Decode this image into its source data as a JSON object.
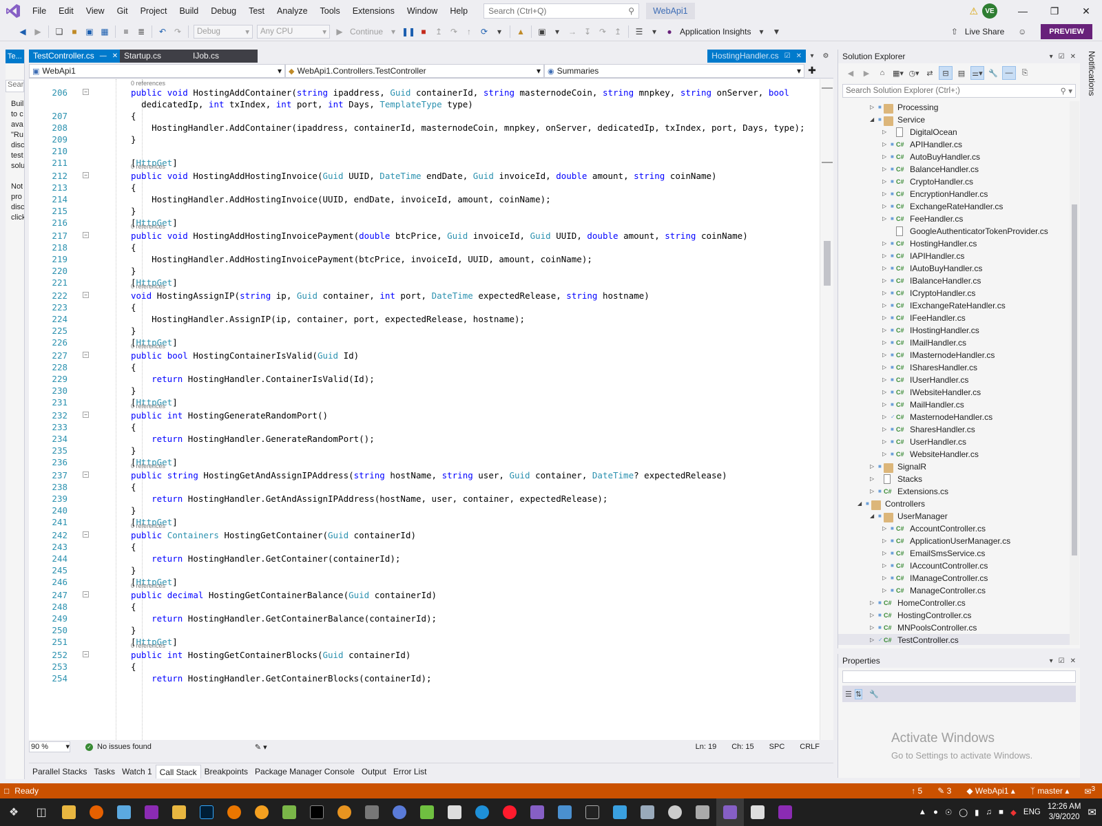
{
  "menu": {
    "items": [
      "File",
      "Edit",
      "View",
      "Git",
      "Project",
      "Build",
      "Debug",
      "Test",
      "Analyze",
      "Tools",
      "Extensions",
      "Window",
      "Help"
    ],
    "search_placeholder": "Search (Ctrl+Q)",
    "app_name": "WebApi1",
    "user_initials": "VE"
  },
  "toolbar": {
    "config": "Debug",
    "platform": "Any CPU",
    "continue_label": "Continue",
    "insights_label": "Application Insights",
    "live_share_label": "Live Share",
    "preview_label": "PREVIEW"
  },
  "left_panel": {
    "tab": "Te...",
    "search": "Sear",
    "text_lines": [
      "Buil",
      "to c",
      "ava",
      "\"Ru",
      "disc",
      "test",
      "solu",
      "",
      "Not",
      "pro",
      "disc",
      "click"
    ]
  },
  "doc_tabs": [
    {
      "label": "TestController.cs",
      "active": true
    },
    {
      "label": "Startup.cs",
      "active": false
    },
    {
      "label": "IJob.cs",
      "active": false
    }
  ],
  "doc_tab_right": "HostingHandler.cs",
  "nav": {
    "project": "WebApi1",
    "class": "WebApi1.Controllers.TestController",
    "member": "Summaries"
  },
  "code": {
    "refs_label": "0 references",
    "lines": [
      {
        "n": "206",
        "t": "public void HostingAddContainer(string ipaddress, Guid containerId, string masternodeCoin, string mnpkey, string onServer, bool"
      },
      {
        "n": "",
        "t": "  dedicatedIp, int txIndex, int port, int Days, TemplateType type)"
      },
      {
        "n": "207",
        "t": "{"
      },
      {
        "n": "208",
        "t": "    HostingHandler.AddContainer(ipaddress, containerId, masternodeCoin, mnpkey, onServer, dedicatedIp, txIndex, port, Days, type);"
      },
      {
        "n": "209",
        "t": "}"
      },
      {
        "n": "210",
        "t": ""
      },
      {
        "n": "211",
        "t": "[HttpGet]"
      },
      {
        "n": "212",
        "t": "public void HostingAddHostingInvoice(Guid UUID, DateTime endDate, Guid invoiceId, double amount, string coinName)"
      },
      {
        "n": "213",
        "t": "{"
      },
      {
        "n": "214",
        "t": "    HostingHandler.AddHostingInvoice(UUID, endDate, invoiceId, amount, coinName);"
      },
      {
        "n": "215",
        "t": "}"
      },
      {
        "n": "216",
        "t": "[HttpGet]"
      },
      {
        "n": "217",
        "t": "public void HostingAddHostingInvoicePayment(double btcPrice, Guid invoiceId, Guid UUID, double amount, string coinName)"
      },
      {
        "n": "218",
        "t": "{"
      },
      {
        "n": "219",
        "t": "    HostingHandler.AddHostingInvoicePayment(btcPrice, invoiceId, UUID, amount, coinName);"
      },
      {
        "n": "220",
        "t": "}"
      },
      {
        "n": "221",
        "t": "[HttpGet]"
      },
      {
        "n": "222",
        "t": "void HostingAssignIP(string ip, Guid container, int port, DateTime expectedRelease, string hostname)"
      },
      {
        "n": "223",
        "t": "{"
      },
      {
        "n": "224",
        "t": "    HostingHandler.AssignIP(ip, container, port, expectedRelease, hostname);"
      },
      {
        "n": "225",
        "t": "}"
      },
      {
        "n": "226",
        "t": "[HttpGet]"
      },
      {
        "n": "227",
        "t": "public bool HostingContainerIsValid(Guid Id)"
      },
      {
        "n": "228",
        "t": "{"
      },
      {
        "n": "229",
        "t": "    return HostingHandler.ContainerIsValid(Id);"
      },
      {
        "n": "230",
        "t": "}"
      },
      {
        "n": "231",
        "t": "[HttpGet]"
      },
      {
        "n": "232",
        "t": "public int HostingGenerateRandomPort()"
      },
      {
        "n": "233",
        "t": "{"
      },
      {
        "n": "234",
        "t": "    return HostingHandler.GenerateRandomPort();"
      },
      {
        "n": "235",
        "t": "}"
      },
      {
        "n": "236",
        "t": "[HttpGet]"
      },
      {
        "n": "237",
        "t": "public string HostingGetAndAssignIPAddress(string hostName, string user, Guid container, DateTime? expectedRelease)"
      },
      {
        "n": "238",
        "t": "{"
      },
      {
        "n": "239",
        "t": "    return HostingHandler.GetAndAssignIPAddress(hostName, user, container, expectedRelease);"
      },
      {
        "n": "240",
        "t": "}"
      },
      {
        "n": "241",
        "t": "[HttpGet]"
      },
      {
        "n": "242",
        "t": "public Containers HostingGetContainer(Guid containerId)"
      },
      {
        "n": "243",
        "t": "{"
      },
      {
        "n": "244",
        "t": "    return HostingHandler.GetContainer(containerId);"
      },
      {
        "n": "245",
        "t": "}"
      },
      {
        "n": "246",
        "t": "[HttpGet]"
      },
      {
        "n": "247",
        "t": "public decimal HostingGetContainerBalance(Guid containerId)"
      },
      {
        "n": "248",
        "t": "{"
      },
      {
        "n": "249",
        "t": "    return HostingHandler.GetContainerBalance(containerId);"
      },
      {
        "n": "250",
        "t": "}"
      },
      {
        "n": "251",
        "t": "[HttpGet]"
      },
      {
        "n": "252",
        "t": "public int HostingGetContainerBlocks(Guid containerId)"
      },
      {
        "n": "253",
        "t": "{"
      },
      {
        "n": "254",
        "t": "    return HostingHandler.GetContainerBlocks(containerId);"
      }
    ]
  },
  "editor_status": {
    "zoom": "90 %",
    "issues": "No issues found",
    "ln": "Ln: 19",
    "ch": "Ch: 15",
    "spc": "SPC",
    "eol": "CRLF"
  },
  "bottom_tabs": [
    {
      "label": "Parallel Stacks",
      "active": false
    },
    {
      "label": "Tasks",
      "active": false
    },
    {
      "label": "Watch 1",
      "active": false
    },
    {
      "label": "Call Stack",
      "active": true
    },
    {
      "label": "Breakpoints",
      "active": false
    },
    {
      "label": "Package Manager Console",
      "active": false
    },
    {
      "label": "Output",
      "active": false
    },
    {
      "label": "Error List",
      "active": false
    }
  ],
  "solution_explorer": {
    "title": "Solution Explorer",
    "search_placeholder": "Search Solution Explorer (Ctrl+;)",
    "items": [
      {
        "label": "Processing",
        "level": 3,
        "kind": "folder",
        "expanded": false
      },
      {
        "label": "Service",
        "level": 3,
        "kind": "folder",
        "expanded": true
      },
      {
        "label": "DigitalOcean",
        "level": 4,
        "kind": "page",
        "expanded": false
      },
      {
        "label": "APIHandler.cs",
        "level": 4,
        "kind": "cs",
        "expanded": false
      },
      {
        "label": "AutoBuyHandler.cs",
        "level": 4,
        "kind": "cs",
        "expanded": false
      },
      {
        "label": "BalanceHandler.cs",
        "level": 4,
        "kind": "cs",
        "expanded": false
      },
      {
        "label": "CryptoHandler.cs",
        "level": 4,
        "kind": "cs",
        "expanded": false
      },
      {
        "label": "EncryptionHandler.cs",
        "level": 4,
        "kind": "cs",
        "expanded": false
      },
      {
        "label": "ExchangeRateHandler.cs",
        "level": 4,
        "kind": "cs",
        "expanded": false
      },
      {
        "label": "FeeHandler.cs",
        "level": 4,
        "kind": "cs",
        "expanded": false
      },
      {
        "label": "GoogleAuthenticatorTokenProvider.cs",
        "level": 4,
        "kind": "page",
        "expanded": null
      },
      {
        "label": "HostingHandler.cs",
        "level": 4,
        "kind": "cs",
        "expanded": false
      },
      {
        "label": "IAPIHandler.cs",
        "level": 4,
        "kind": "cs",
        "expanded": false
      },
      {
        "label": "IAutoBuyHandler.cs",
        "level": 4,
        "kind": "cs",
        "expanded": false
      },
      {
        "label": "IBalanceHandler.cs",
        "level": 4,
        "kind": "cs",
        "expanded": false
      },
      {
        "label": "ICryptoHandler.cs",
        "level": 4,
        "kind": "cs",
        "expanded": false
      },
      {
        "label": "IExchangeRateHandler.cs",
        "level": 4,
        "kind": "cs",
        "expanded": false
      },
      {
        "label": "IFeeHandler.cs",
        "level": 4,
        "kind": "cs",
        "expanded": false
      },
      {
        "label": "IHostingHandler.cs",
        "level": 4,
        "kind": "cs",
        "expanded": false
      },
      {
        "label": "IMailHandler.cs",
        "level": 4,
        "kind": "cs",
        "expanded": false
      },
      {
        "label": "IMasternodeHandler.cs",
        "level": 4,
        "kind": "cs",
        "expanded": false
      },
      {
        "label": "ISharesHandler.cs",
        "level": 4,
        "kind": "cs",
        "expanded": false
      },
      {
        "label": "IUserHandler.cs",
        "level": 4,
        "kind": "cs",
        "expanded": false
      },
      {
        "label": "IWebsiteHandler.cs",
        "level": 4,
        "kind": "cs",
        "expanded": false
      },
      {
        "label": "MailHandler.cs",
        "level": 4,
        "kind": "cs",
        "expanded": false
      },
      {
        "label": "MasternodeHandler.cs",
        "level": 4,
        "kind": "cs-check",
        "expanded": false
      },
      {
        "label": "SharesHandler.cs",
        "level": 4,
        "kind": "cs",
        "expanded": false
      },
      {
        "label": "UserHandler.cs",
        "level": 4,
        "kind": "cs",
        "expanded": false
      },
      {
        "label": "WebsiteHandler.cs",
        "level": 4,
        "kind": "cs",
        "expanded": false
      },
      {
        "label": "SignalR",
        "level": 3,
        "kind": "folder",
        "expanded": false
      },
      {
        "label": "Stacks",
        "level": 3,
        "kind": "page",
        "expanded": false
      },
      {
        "label": "Extensions.cs",
        "level": 3,
        "kind": "cs",
        "expanded": false
      },
      {
        "label": "Controllers",
        "level": 2,
        "kind": "folder",
        "expanded": true
      },
      {
        "label": "UserManager",
        "level": 3,
        "kind": "folder",
        "expanded": true
      },
      {
        "label": "AccountController.cs",
        "level": 4,
        "kind": "cs",
        "expanded": false
      },
      {
        "label": "ApplicationUserManager.cs",
        "level": 4,
        "kind": "cs",
        "expanded": false
      },
      {
        "label": "EmailSmsService.cs",
        "level": 4,
        "kind": "cs",
        "expanded": false
      },
      {
        "label": "IAccountController.cs",
        "level": 4,
        "kind": "cs",
        "expanded": false
      },
      {
        "label": "IManageController.cs",
        "level": 4,
        "kind": "cs",
        "expanded": false
      },
      {
        "label": "ManageController.cs",
        "level": 4,
        "kind": "cs",
        "expanded": false
      },
      {
        "label": "HomeController.cs",
        "level": 3,
        "kind": "cs",
        "expanded": false
      },
      {
        "label": "HostingController.cs",
        "level": 3,
        "kind": "cs",
        "expanded": false
      },
      {
        "label": "MNPoolsController.cs",
        "level": 3,
        "kind": "cs",
        "expanded": false
      },
      {
        "label": "TestController.cs",
        "level": 3,
        "kind": "cs-check",
        "expanded": false
      }
    ]
  },
  "properties": {
    "title": "Properties"
  },
  "activate": {
    "line1": "Activate Windows",
    "line2": "Go to Settings to activate Windows."
  },
  "notifications_label": "Notifications",
  "statusbar": {
    "ready": "Ready",
    "up_count": "5",
    "edit_count": "3",
    "project": "WebApi1",
    "branch": "master",
    "notif_count": "3"
  },
  "taskbar": {
    "lang": "ENG",
    "time": "12:26 AM",
    "date": "3/9/2020"
  },
  "colors": {
    "accent": "#007acc",
    "status_bar": "#ca5100",
    "preview": "#68217a",
    "keyword": "#0000ff",
    "type": "#2b91af"
  }
}
